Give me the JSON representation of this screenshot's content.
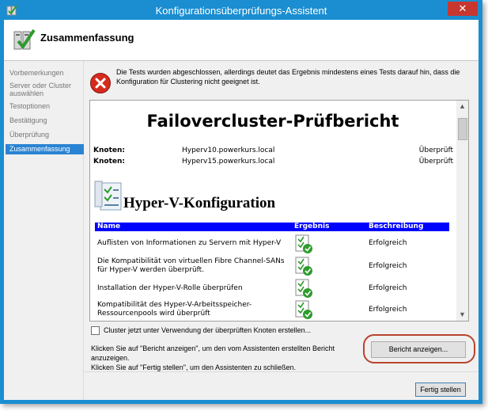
{
  "window": {
    "title": "Konfigurationsüberprüfungs-Assistent",
    "close_label": "✕"
  },
  "header": {
    "title": "Zusammenfassung"
  },
  "nav": {
    "items": [
      {
        "label": "Vorbemerkungen"
      },
      {
        "label": "Server oder Cluster auswählen"
      },
      {
        "label": "Testoptionen"
      },
      {
        "label": "Bestätigung"
      },
      {
        "label": "Überprüfung"
      },
      {
        "label": "Zusammenfassung"
      }
    ],
    "active_index": 5
  },
  "status": {
    "icon": "error-icon",
    "text": "Die Tests wurden abgeschlossen, allerdings deutet das Ergebnis mindestens eines Tests darauf hin, dass die Konfiguration für Clustering nicht geeignet ist."
  },
  "report": {
    "title": "Failovercluster-Prüfbericht",
    "nodes": [
      {
        "label": "Knoten:",
        "value": "Hyperv10.powerkurs.local",
        "status": "Überprüft"
      },
      {
        "label": "Knoten:",
        "value": "Hyperv15.powerkurs.local",
        "status": "Überprüft"
      }
    ],
    "section_title": "Hyper-V-Konfiguration",
    "columns": {
      "name": "Name",
      "result": "Ergebnis",
      "description": "Beschreibung"
    },
    "rows": [
      {
        "name": "Auflisten von Informationen zu Servern mit Hyper-V",
        "description": "Erfolgreich"
      },
      {
        "name": "Die Kompatibilität von virtuellen Fibre Channel-SANs für Hyper-V werden überprüft.",
        "description": "Erfolgreich"
      },
      {
        "name": "Installation der Hyper-V-Rolle überprüfen",
        "description": "Erfolgreich"
      },
      {
        "name": "Kompatibilität des Hyper-V-Arbeitsspeicher-Ressourcenpools wird überprüft",
        "description": "Erfolgreich"
      }
    ]
  },
  "checkbox": {
    "label": "Cluster jetzt unter Verwendung der überprüften Knoten erstellen...",
    "checked": false
  },
  "hint": {
    "line1": "Klicken Sie auf \"Bericht anzeigen\", um den vom Assistenten erstellten Bericht anzuzeigen.",
    "line2": "Klicken Sie auf \"Fertig stellen\", um den Assistenten zu schließen."
  },
  "buttons": {
    "view_report": "Bericht anzeigen...",
    "finish": "Fertig stellen"
  },
  "colors": {
    "titlebar": "#1a8ed1",
    "nav_active": "#2b84d3",
    "table_header": "#0000ff",
    "highlight": "#b8442f"
  }
}
